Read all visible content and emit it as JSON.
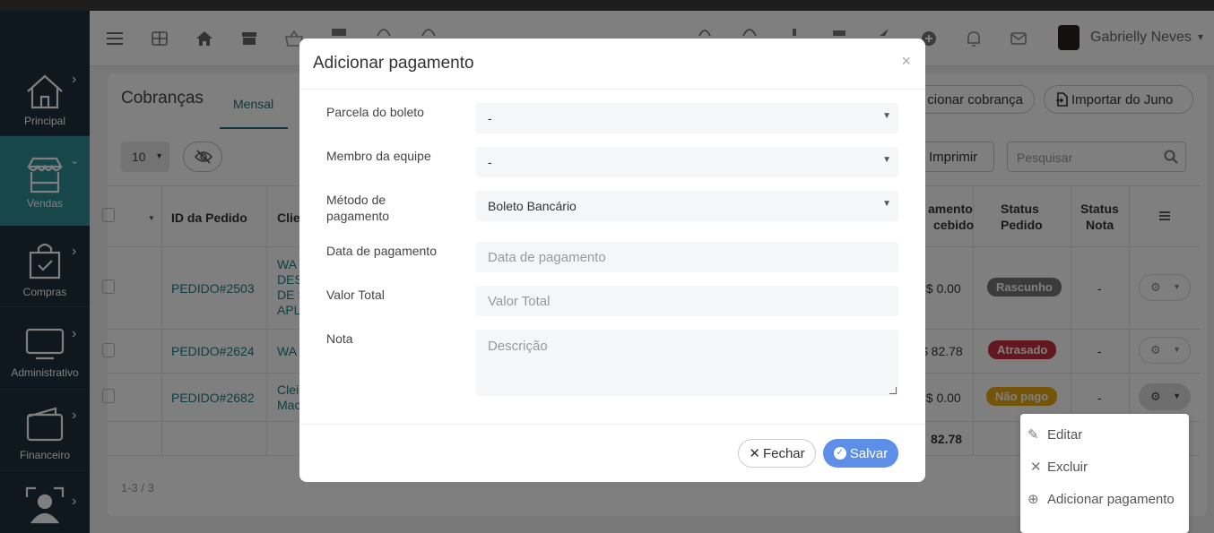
{
  "sidebar": {
    "items": [
      {
        "label": "Principal",
        "icon": "house-icon"
      },
      {
        "label": "Vendas",
        "icon": "store-icon"
      },
      {
        "label": "Compras",
        "icon": "shopping-bag-icon"
      },
      {
        "label": "Administrativo",
        "icon": "monitor-icon"
      },
      {
        "label": "Financeiro",
        "icon": "wallet-icon"
      },
      {
        "label": "",
        "icon": "user-scan-icon"
      }
    ]
  },
  "header": {
    "user_name": "Gabrielly Neves"
  },
  "page": {
    "title": "Cobranças",
    "tab_active": "Mensal",
    "add_charge_label": "cionar cobrança",
    "import_label": "Importar do Juno",
    "page_size": "10",
    "print_label": "Imprimir",
    "search_placeholder": "Pesquisar",
    "pagination": "1-3 / 3"
  },
  "table": {
    "headers": {
      "id": "ID da Pedido",
      "client": "Clie",
      "payment_received_1": "amento",
      "payment_received_2": "cebido",
      "status_pedido_1": "Status",
      "status_pedido_2": "Pedido",
      "status_nota_1": "Status",
      "status_nota_2": "Nota"
    },
    "rows": [
      {
        "id": "PEDIDO#2503",
        "client_1": "WA",
        "client_2": "DES",
        "client_3": "DE S",
        "client_4": "APL",
        "received": "2$ 0.00",
        "status": "Rascunho",
        "status_color": "#777777",
        "nota": "-"
      },
      {
        "id": "PEDIDO#2624",
        "client_1": "WA",
        "received": "$ 82.78",
        "status": "Atrasado",
        "status_color": "#c82e3c",
        "nota": "-"
      },
      {
        "id": "PEDIDO#2682",
        "client_1": "Clei",
        "client_2": "Mac",
        "received": "2$ 0.00",
        "status": "Não pago",
        "status_color": "#e8a912",
        "nota": "-"
      }
    ],
    "total": "82.78"
  },
  "dropdown": {
    "edit": "Editar",
    "delete": "Excluir",
    "add_payment": "Adicionar pagamento"
  },
  "modal": {
    "title": "Adicionar pagamento",
    "close_symbol": "×",
    "fields": {
      "parcela_label": "Parcela do boleto",
      "parcela_value": "-",
      "membro_label": "Membro da equipe",
      "membro_value": "-",
      "metodo_label": "Método de pagamento",
      "metodo_value": "Boleto Bancário",
      "data_label": "Data de pagamento",
      "data_placeholder": "Data de pagamento",
      "valor_label": "Valor Total",
      "valor_placeholder": "Valor Total",
      "nota_label": "Nota",
      "nota_placeholder": "Descrição"
    },
    "close_button": "Fechar",
    "save_button": "Salvar"
  },
  "colors": {
    "accent": "#1a7d84",
    "sidebar": "#1d313c",
    "sidebar_active": "#2f8f96",
    "save": "#5d8fe8"
  }
}
